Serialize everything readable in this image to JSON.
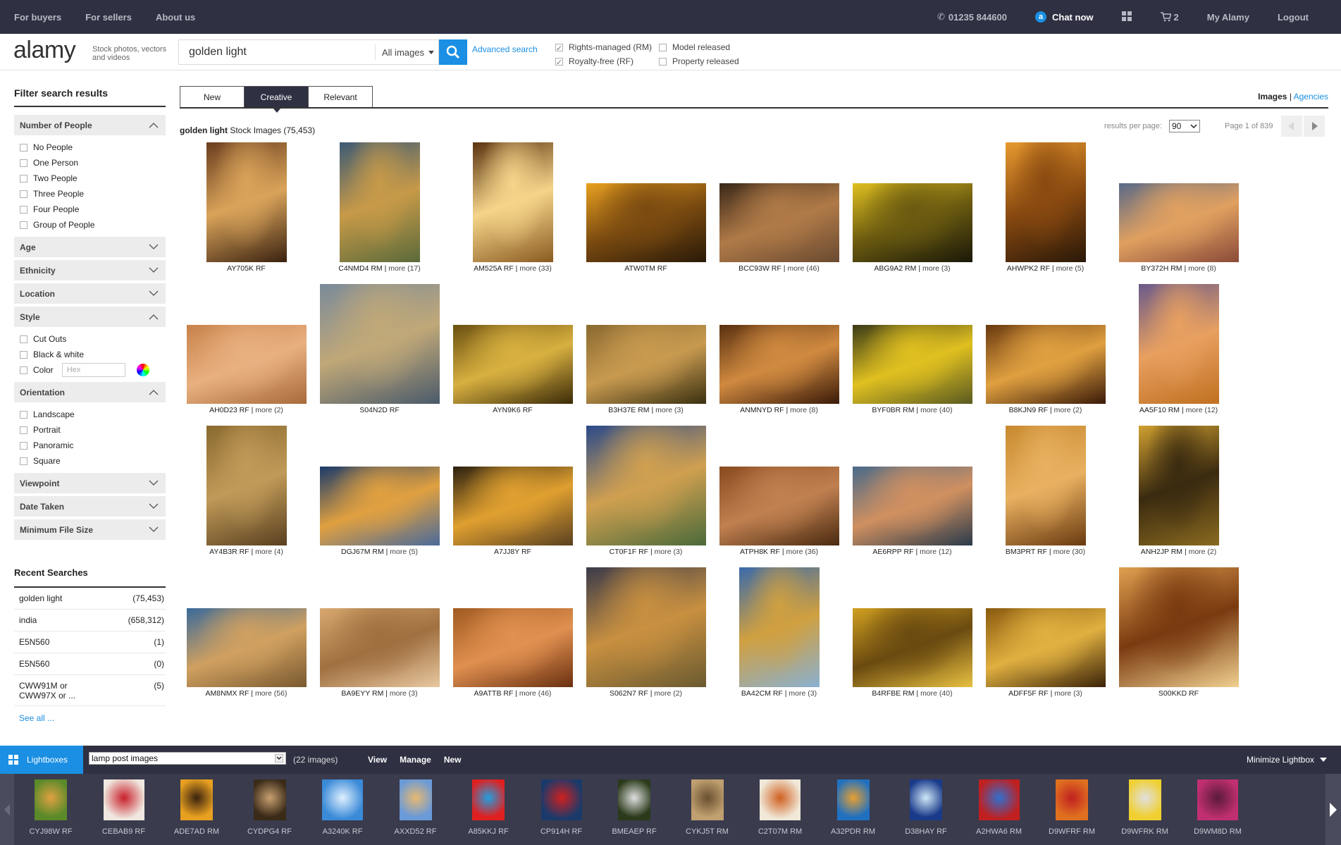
{
  "topbar": {
    "nav_left": [
      "For buyers",
      "For sellers",
      "About us"
    ],
    "phone": "01235 844600",
    "chat": "Chat now",
    "cart_count": "2",
    "my_alamy": "My Alamy",
    "logout": "Logout"
  },
  "header": {
    "logo": "alamy",
    "tagline": "Stock photos, vectors and videos",
    "search_query": "golden light",
    "search_type": "All images",
    "advanced": "Advanced search",
    "licences": [
      {
        "label": "Rights-managed (RM)",
        "checked": true
      },
      {
        "label": "Royalty-free (RF)",
        "checked": true
      }
    ],
    "releases": [
      {
        "label": "Model released",
        "checked": false
      },
      {
        "label": "Property released",
        "checked": false
      }
    ]
  },
  "sidebar": {
    "title": "Filter search results",
    "facets": [
      {
        "name": "Number of People",
        "open": true,
        "items": [
          "No People",
          "One Person",
          "Two People",
          "Three People",
          "Four People",
          "Group of People"
        ]
      },
      {
        "name": "Age",
        "open": false,
        "items": []
      },
      {
        "name": "Ethnicity",
        "open": false,
        "items": []
      },
      {
        "name": "Location",
        "open": false,
        "items": []
      },
      {
        "name": "Style",
        "open": true,
        "items": [
          "Cut Outs",
          "Black & white",
          "Color"
        ]
      },
      {
        "name": "Orientation",
        "open": true,
        "items": [
          "Landscape",
          "Portrait",
          "Panoramic",
          "Square"
        ]
      },
      {
        "name": "Viewpoint",
        "open": false,
        "items": []
      },
      {
        "name": "Date Taken",
        "open": false,
        "items": []
      },
      {
        "name": "Minimum File Size",
        "open": false,
        "items": []
      }
    ],
    "hex_placeholder": "Hex",
    "recent_title": "Recent Searches",
    "recent": [
      {
        "term": "golden light",
        "count": "(75,453)"
      },
      {
        "term": "india",
        "count": "(658,312)"
      },
      {
        "term": "E5N560",
        "count": "(1)"
      },
      {
        "term": "E5N560",
        "count": "(0)"
      },
      {
        "term": "CWW91M or CWW97X or ...",
        "count": "(5)"
      }
    ],
    "see_all": "See all ..."
  },
  "main": {
    "tabs": [
      {
        "label": "New",
        "active": false
      },
      {
        "label": "Creative",
        "active": true
      },
      {
        "label": "Relevant",
        "active": false
      }
    ],
    "images_label": "Images",
    "agencies_label": "Agencies",
    "query_bold": "golden light",
    "query_rest": "Stock Images (75,453)",
    "per_page_label": "results per page:",
    "per_page_value": "90",
    "page_info": "Page 1 of 839",
    "results": [
      {
        "id": "AY705K RF",
        "more": "",
        "orient": "portrait",
        "colors": [
          "#6b3e1f",
          "#d9a35a",
          "#3a2210"
        ]
      },
      {
        "id": "C4NMD4 RM",
        "more": "more (17)",
        "orient": "portrait",
        "colors": [
          "#3c5a75",
          "#c79a48",
          "#5a6a3a"
        ]
      },
      {
        "id": "AM525A RF",
        "more": "more (33)",
        "orient": "portrait",
        "colors": [
          "#5a3410",
          "#f5d58a",
          "#8a5a20"
        ]
      },
      {
        "id": "ATW0TM RF",
        "more": "",
        "orient": "landscape",
        "colors": [
          "#e8a020",
          "#7a4a10",
          "#2a1a08"
        ]
      },
      {
        "id": "BCC93W RF",
        "more": "more (46)",
        "orient": "landscape",
        "colors": [
          "#3a2818",
          "#b07a48",
          "#6a4a30"
        ]
      },
      {
        "id": "ABG9A2 RM",
        "more": "more (3)",
        "orient": "landscape",
        "colors": [
          "#e0c020",
          "#6a5a10",
          "#1a1808"
        ]
      },
      {
        "id": "AHWPK2 RF",
        "more": "more (5)",
        "orient": "portrait",
        "colors": [
          "#e89a30",
          "#8a4a10",
          "#2a1808"
        ]
      },
      {
        "id": "BY372H RM",
        "more": "more (8)",
        "orient": "landscape",
        "colors": [
          "#5a6a88",
          "#e0a060",
          "#8a4a38"
        ]
      },
      {
        "id": "AH0D23 RF",
        "more": "more (2)",
        "orient": "landscape",
        "colors": [
          "#c8824a",
          "#e8b080",
          "#a86a3a"
        ]
      },
      {
        "id": "S04N2D RF",
        "more": "",
        "orient": "square",
        "colors": [
          "#7a8a9a",
          "#c0a878",
          "#4a5a6a"
        ]
      },
      {
        "id": "AYN9K6 RF",
        "more": "",
        "orient": "landscape",
        "colors": [
          "#6a5010",
          "#d8b040",
          "#3a2a08"
        ]
      },
      {
        "id": "B3H37E RM",
        "more": "more (3)",
        "orient": "landscape",
        "colors": [
          "#8a6a30",
          "#c89a50",
          "#3a3010"
        ]
      },
      {
        "id": "ANMNYD RF",
        "more": "more (8)",
        "orient": "landscape",
        "colors": [
          "#5a3010",
          "#d08a40",
          "#3a1a08"
        ]
      },
      {
        "id": "BYF0BR RM",
        "more": "more (40)",
        "orient": "landscape",
        "colors": [
          "#3a3a18",
          "#e0c020",
          "#5a5a20"
        ]
      },
      {
        "id": "B8KJN9 RF",
        "more": "more (2)",
        "orient": "landscape",
        "colors": [
          "#6a3a10",
          "#e0a040",
          "#3a1a08"
        ]
      },
      {
        "id": "AA5F10 RM",
        "more": "more (12)",
        "orient": "portrait",
        "colors": [
          "#6a5a8a",
          "#e8a060",
          "#c07020"
        ]
      },
      {
        "id": "AY4B3R RF",
        "more": "more (4)",
        "orient": "portrait",
        "colors": [
          "#8a6a30",
          "#c09a58",
          "#5a4020"
        ]
      },
      {
        "id": "DGJ67M RM",
        "more": "more (5)",
        "orient": "landscape",
        "colors": [
          "#1a3a6a",
          "#e0a040",
          "#4a6a9a"
        ]
      },
      {
        "id": "A7JJ8Y RF",
        "more": "",
        "orient": "landscape",
        "colors": [
          "#2a2010",
          "#e0a030",
          "#5a4020"
        ]
      },
      {
        "id": "CT0F1F RF",
        "more": "more (3)",
        "orient": "square",
        "colors": [
          "#2a4a8a",
          "#d0a050",
          "#4a6a3a"
        ]
      },
      {
        "id": "ATPH8K RF",
        "more": "more (36)",
        "orient": "landscape",
        "colors": [
          "#8a4a20",
          "#c08050",
          "#4a2a10"
        ]
      },
      {
        "id": "AE6RPP RF",
        "more": "more (12)",
        "orient": "landscape",
        "colors": [
          "#4a6a8a",
          "#d09060",
          "#2a3a4a"
        ]
      },
      {
        "id": "BM3PRT RF",
        "more": "more (30)",
        "orient": "portrait",
        "colors": [
          "#c88a30",
          "#e8b060",
          "#6a3a10"
        ]
      },
      {
        "id": "ANH2JP RM",
        "more": "more (2)",
        "orient": "portrait",
        "colors": [
          "#d0a030",
          "#3a2a10",
          "#8a6a20"
        ]
      },
      {
        "id": "AM8NMX RF",
        "more": "more (56)",
        "orient": "landscape",
        "colors": [
          "#3a6a9a",
          "#d0a060",
          "#7a5a30"
        ]
      },
      {
        "id": "BA9EYY RM",
        "more": "more (3)",
        "orient": "landscape",
        "colors": [
          "#d8a870",
          "#a07040",
          "#e8c8a0"
        ]
      },
      {
        "id": "A9ATTB RF",
        "more": "more (46)",
        "orient": "landscape",
        "colors": [
          "#a05a20",
          "#e09050",
          "#6a3010"
        ]
      },
      {
        "id": "S062N7 RF",
        "more": "more (2)",
        "orient": "square",
        "colors": [
          "#3a3a4a",
          "#c89040",
          "#6a5a30"
        ]
      },
      {
        "id": "BA42CM RF",
        "more": "more (3)",
        "orient": "portrait",
        "colors": [
          "#3a6aaa",
          "#d0a040",
          "#8ab0d0"
        ]
      },
      {
        "id": "B4RFBE RM",
        "more": "more (40)",
        "orient": "landscape",
        "colors": [
          "#d0a020",
          "#6a4a10",
          "#e8c040"
        ]
      },
      {
        "id": "ADFF5F RF",
        "more": "more (3)",
        "orient": "landscape",
        "colors": [
          "#8a5a10",
          "#e0b040",
          "#3a2208"
        ]
      },
      {
        "id": "S00KKD RF",
        "more": "",
        "orient": "square",
        "colors": [
          "#e0a050",
          "#7a3a10",
          "#f0d090"
        ]
      }
    ]
  },
  "lightbox": {
    "label": "Lightboxes",
    "selected": "lamp post images",
    "count": "(22 images)",
    "actions": [
      "View",
      "Manage",
      "New"
    ],
    "minimize": "Minimize Lightbox",
    "items": [
      {
        "id": "CYJ98W RF",
        "colors": [
          "#5a8a2a",
          "#e0a040"
        ]
      },
      {
        "id": "CEBAB9 RF",
        "colors": [
          "#f0e8e0",
          "#c8202a"
        ]
      },
      {
        "id": "ADE7AD RM",
        "colors": [
          "#e8a020",
          "#3a2210"
        ]
      },
      {
        "id": "CYDPG4 RF",
        "colors": [
          "#3a2a18",
          "#c8a070"
        ]
      },
      {
        "id": "A3240K RF",
        "colors": [
          "#3a8ad8",
          "#e0f0ff"
        ]
      },
      {
        "id": "AXXD52 RF",
        "colors": [
          "#6a9ad8",
          "#e8b870"
        ]
      },
      {
        "id": "A85KKJ RF",
        "colors": [
          "#e02020",
          "#20a0e0"
        ]
      },
      {
        "id": "CP914H RF",
        "colors": [
          "#1a3a6a",
          "#d02020"
        ]
      },
      {
        "id": "BMEAEP RF",
        "colors": [
          "#2a3a1a",
          "#e0e0e0"
        ]
      },
      {
        "id": "CYKJ5T RM",
        "colors": [
          "#c0a070",
          "#6a5030"
        ]
      },
      {
        "id": "C2T07M RM",
        "colors": [
          "#f0e8d8",
          "#d06020"
        ]
      },
      {
        "id": "A32PDR RM",
        "colors": [
          "#2070c0",
          "#e8a030"
        ]
      },
      {
        "id": "D38HAY RF",
        "colors": [
          "#1a3a8a",
          "#d0e8f8"
        ]
      },
      {
        "id": "A2HWA6 RM",
        "colors": [
          "#c02020",
          "#3070d0"
        ]
      },
      {
        "id": "D9WFRF RM",
        "colors": [
          "#e07020",
          "#c02020"
        ]
      },
      {
        "id": "D9WFRK RM",
        "colors": [
          "#f0d030",
          "#e0e0e0"
        ]
      },
      {
        "id": "D9WM8D RM",
        "colors": [
          "#c03070",
          "#5a1a3a"
        ]
      }
    ]
  },
  "colors": {
    "navy": "#2f3042",
    "accent": "#1a8fe3"
  }
}
